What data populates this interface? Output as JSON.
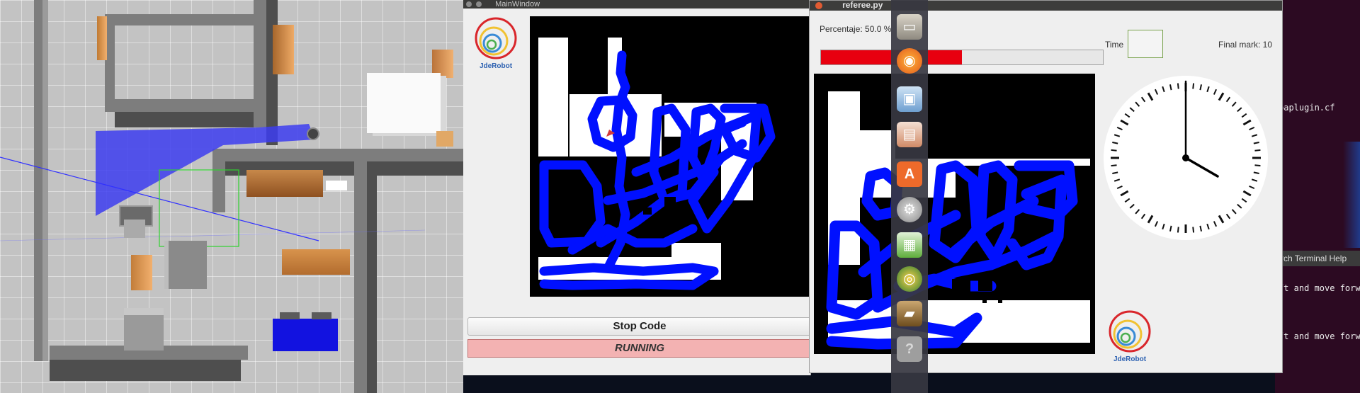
{
  "main_window": {
    "title": "MainWindow",
    "logo_text": "JdeRobot",
    "stop_button_label": "Stop Code",
    "status_text": "RUNNING"
  },
  "referee": {
    "title": "referee.py",
    "percentage_label": "Percentaje: 50.0 %",
    "percentage_value": 50.0,
    "time_label": "Time",
    "time_value": "",
    "final_mark_label": "Final mark: 10",
    "logo_text": "JdeRobot",
    "clock": {
      "hour": 4,
      "minute": 0
    }
  },
  "terminal": {
    "line1": "paplugin.cf",
    "menu": "rch  Terminal  Help",
    "line2": "ft and move forw",
    "line3": "ft and move forw"
  },
  "dock": {
    "icons": [
      "files-icon",
      "firefox-icon",
      "image-viewer-icon",
      "impress-icon",
      "software-center-icon",
      "settings-icon",
      "calc-icon",
      "chrome-icon",
      "app-icon",
      "help-icon"
    ]
  },
  "colors": {
    "accent_red": "#e8000f",
    "path_blue": "#0010ff",
    "status_bg": "#f3b2b2"
  }
}
